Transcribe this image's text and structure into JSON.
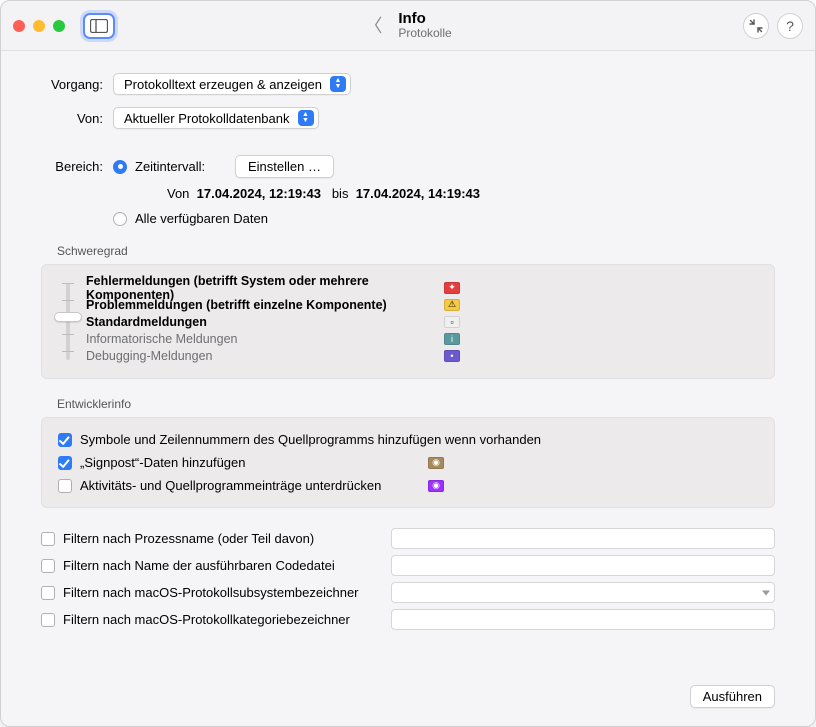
{
  "window": {
    "title": "Info",
    "subtitle": "Protokolle"
  },
  "toolbar": {
    "collapse_icon": "↘↖",
    "help": "?"
  },
  "form": {
    "vorgang_label": "Vorgang:",
    "vorgang_value": "Protokolltext erzeugen & anzeigen",
    "von_label": "Von:",
    "von_value": "Aktueller Protokolldatenbank",
    "bereich_label": "Bereich:",
    "opt_zeit_label": "Zeitintervall:",
    "einstellen_btn": "Einstellen …",
    "range_von_label": "Von",
    "range_start": "17.04.2024, 12:19:43",
    "range_bis_label": "bis",
    "range_end": "17.04.2024, 14:19:43",
    "opt_all_label": "Alle verfügbaren Daten"
  },
  "severity": {
    "section": "Schweregrad",
    "items": [
      {
        "label": "Fehlermeldungen (betrifft System oder mehrere Komponenten)",
        "badge_bg": "#e53e3e",
        "badge_glyph": "✦",
        "bold": true
      },
      {
        "label": "Problemmeldungen (betrifft einzelne Komponente)",
        "badge_bg": "#f6c945",
        "badge_glyph": "⚠",
        "bold": true
      },
      {
        "label": "Standardmeldungen",
        "badge_bg": "#f0f0f0",
        "badge_glyph": "▫",
        "bold": true
      },
      {
        "label": "Informatorische Meldungen",
        "badge_bg": "#5a9a9f",
        "badge_glyph": "i",
        "bold": false
      },
      {
        "label": "Debugging-Meldungen",
        "badge_bg": "#6a5acd",
        "badge_glyph": "•",
        "bold": false
      }
    ],
    "slider_index": 2
  },
  "dev": {
    "section": "Entwicklerinfo",
    "row1": {
      "checked": true,
      "label": "Symbole und Zeilennummern des Quellprogramms hinzufügen wenn vorhanden"
    },
    "row2": {
      "checked": true,
      "label": "„Signpost“-Daten hinzufügen",
      "badge_bg": "#a68a5b",
      "badge_glyph": "◉"
    },
    "row3": {
      "checked": false,
      "label": "Aktivitäts- und Quellprogrammeinträge unterdrücken",
      "badge_bg": "#9b30ff",
      "badge_glyph": "◉"
    }
  },
  "filters": {
    "f1": "Filtern nach Prozessname (oder Teil davon)",
    "f2": "Filtern nach Name der ausführbaren Codedatei",
    "f3": "Filtern nach macOS-Protokollsubsystembezeichner",
    "f4": "Filtern nach macOS-Protokollkategoriebezeichner"
  },
  "footer": {
    "execute": "Ausführen"
  }
}
